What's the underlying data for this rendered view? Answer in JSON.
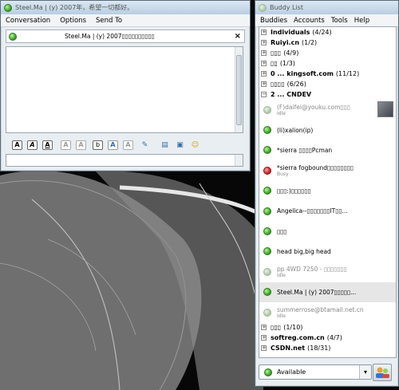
{
  "conversation": {
    "title": "Steel.Ma | (y) 2007年，希望一切都好。",
    "menu": {
      "conversation": "Conversation",
      "options": "Options",
      "send_to": "Send To"
    },
    "tab_title": "Steel.Ma | (y) 2007▯▯▯▯▯▯▯▯▯▯",
    "tab_close": "×",
    "format_buttons": [
      "A",
      "A",
      "A",
      "A",
      "A",
      "b",
      "A",
      "A"
    ]
  },
  "buddylist": {
    "title": "Buddy List",
    "menu": {
      "buddies": "Buddies",
      "accounts": "Accounts",
      "tools": "Tools",
      "help": "Help"
    },
    "groups_top": [
      {
        "name": "Individuals",
        "count": "(4/24)"
      },
      {
        "name": "Ruiyi.cn",
        "count": "(1/2)"
      },
      {
        "name": "▯▯▯",
        "count": "(4/9)"
      },
      {
        "name": "▯▯",
        "count": "(1/3)"
      },
      {
        "name": "0 ... kingsoft.com",
        "count": "(11/12)"
      },
      {
        "name": "▯▯▯▯",
        "count": "(6/26)"
      }
    ],
    "open_group": {
      "name": "2 ... CNDEV",
      "expander": "−"
    },
    "buddies": [
      {
        "name": "(F)daifei@youku.com▯▯▯",
        "status": "Idle",
        "state": "idle"
      },
      {
        "name": "(li)xalion(ip)",
        "status": "",
        "state": "available"
      },
      {
        "name": "*sierra ▯▯▯▯Pcman",
        "status": "",
        "state": "available"
      },
      {
        "name": "*sierra fogbound▯▯▯▯▯▯▯▯",
        "status": "Busy",
        "state": "busy"
      },
      {
        "name": "▯▯▯:)▯▯▯▯▯▯",
        "status": "",
        "state": "available"
      },
      {
        "name": "Angelica--▯▯▯▯▯▯▯IT▯▯...",
        "status": "",
        "state": "available"
      },
      {
        "name": "▯▯▯",
        "status": "",
        "state": "available"
      },
      {
        "name": "head big,big head",
        "status": "",
        "state": "available"
      },
      {
        "name": "pp 4WD 7250 - ▯▯▯▯▯▯▯",
        "status": "Idle",
        "state": "idle"
      },
      {
        "name": "Steel.Ma | (y) 2007▯▯▯▯▯...",
        "status": "",
        "state": "available"
      },
      {
        "name": "summerrose@btamail.net.cn",
        "status": "Idle",
        "state": "idle"
      }
    ],
    "groups_bottom": [
      {
        "name": "▯▯▯",
        "count": "(1/10)"
      },
      {
        "name": "softreg.com.cn",
        "count": "(4/7)"
      },
      {
        "name": "CSDN.net",
        "count": "(18/31)"
      }
    ],
    "status_value": "Available"
  },
  "colors": {
    "available": "#2f9a1a",
    "busy": "#c01a1a",
    "idle": "#a9c6a2",
    "selection": "#e6e6e6"
  }
}
